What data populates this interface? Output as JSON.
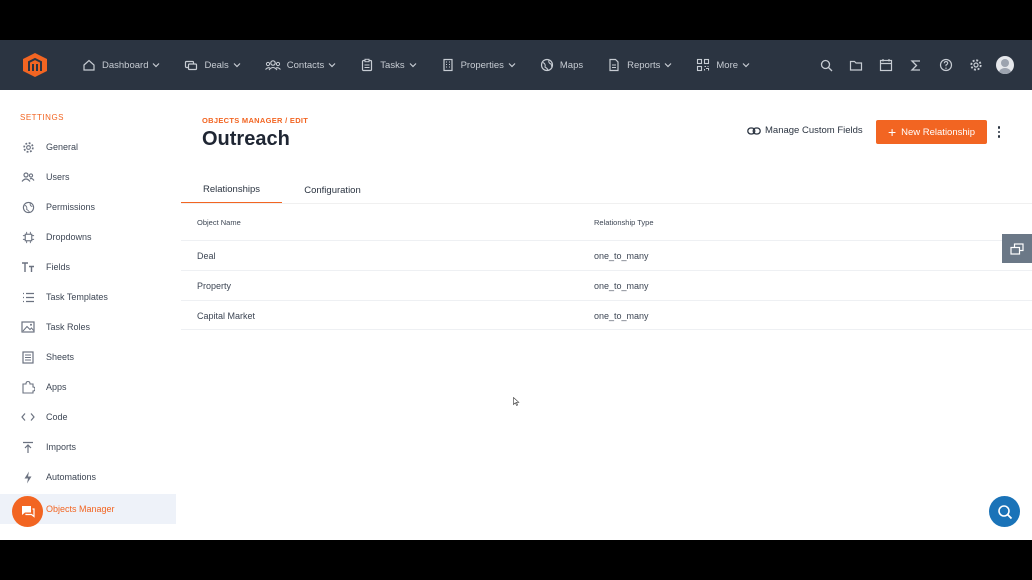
{
  "nav": {
    "items": [
      {
        "label": "Dashboard",
        "icon": "home-icon",
        "has_dropdown": true
      },
      {
        "label": "Deals",
        "icon": "deals-icon",
        "has_dropdown": true
      },
      {
        "label": "Contacts",
        "icon": "contacts-icon",
        "has_dropdown": true
      },
      {
        "label": "Tasks",
        "icon": "clipboard-icon",
        "has_dropdown": true
      },
      {
        "label": "Properties",
        "icon": "building-icon",
        "has_dropdown": true
      },
      {
        "label": "Maps",
        "icon": "globe-icon",
        "has_dropdown": false
      },
      {
        "label": "Reports",
        "icon": "document-icon",
        "has_dropdown": true
      },
      {
        "label": "More",
        "icon": "qr-grid-icon",
        "has_dropdown": true
      }
    ],
    "right_icons": [
      "search-icon",
      "folder-icon",
      "calendar-icon",
      "sigma-icon",
      "help-icon",
      "gear-icon"
    ]
  },
  "sidebar": {
    "title": "SETTINGS",
    "items": [
      {
        "label": "General",
        "icon": "gear-icon"
      },
      {
        "label": "Users",
        "icon": "users-icon"
      },
      {
        "label": "Permissions",
        "icon": "globe-icon"
      },
      {
        "label": "Dropdowns",
        "icon": "chip-icon"
      },
      {
        "label": "Fields",
        "icon": "text-type-icon"
      },
      {
        "label": "Task Templates",
        "icon": "list-icon"
      },
      {
        "label": "Task Roles",
        "icon": "image-icon"
      },
      {
        "label": "Sheets",
        "icon": "sheet-icon"
      },
      {
        "label": "Apps",
        "icon": "puzzle-icon"
      },
      {
        "label": "Code",
        "icon": "code-icon"
      },
      {
        "label": "Imports",
        "icon": "upload-icon"
      },
      {
        "label": "Automations",
        "icon": "bolt-icon"
      },
      {
        "label": "Objects Manager",
        "icon": "objects-icon",
        "active": true
      }
    ]
  },
  "main": {
    "breadcrumb": "OBJECTS MANAGER / EDIT",
    "title": "Outreach",
    "manage_link": "Manage Custom Fields",
    "new_button": "New Relationship",
    "tabs": [
      {
        "label": "Relationships",
        "active": true
      },
      {
        "label": "Configuration",
        "active": false
      }
    ],
    "table": {
      "headers": [
        "Object Name",
        "Relationship Type"
      ],
      "rows": [
        [
          "Deal",
          "one_to_many"
        ],
        [
          "Property",
          "one_to_many"
        ],
        [
          "Capital Market",
          "one_to_many"
        ]
      ]
    }
  },
  "colors": {
    "accent": "#f26522",
    "nav_bg": "#2b3441",
    "help_button": "#1a73b8"
  }
}
